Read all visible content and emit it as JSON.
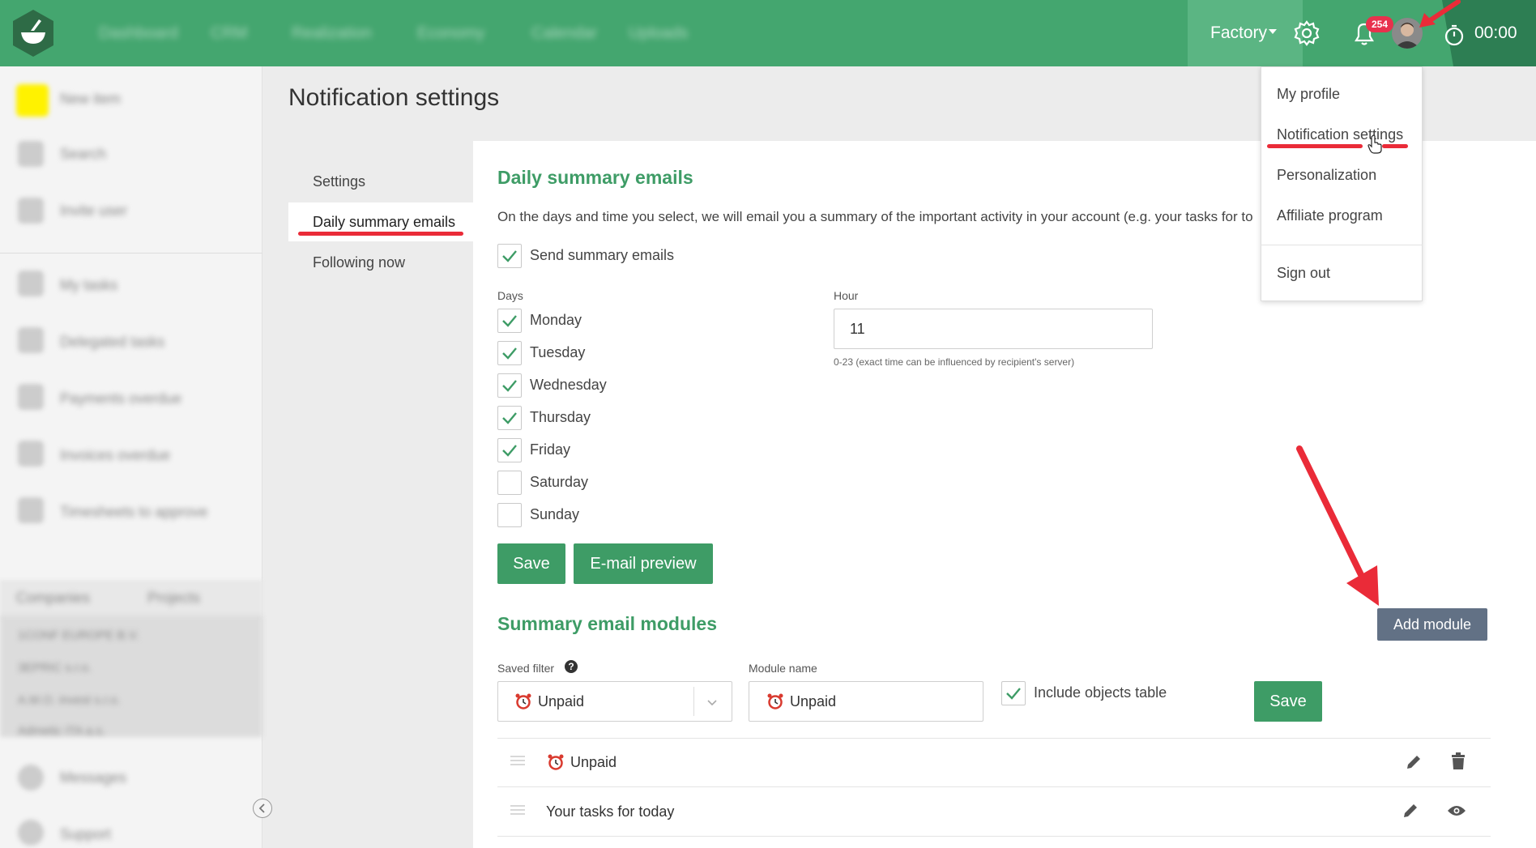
{
  "topbar": {
    "nav_items": [
      "Dashboard",
      "CRM",
      "Realization",
      "Economy",
      "Calendar",
      "Uploads"
    ],
    "company": "Factory",
    "notifications_count": "254",
    "timer": "00:00"
  },
  "sidebar": {
    "items": [
      "New item",
      "Search",
      "Invite user",
      "My tasks",
      "Delegated tasks",
      "Payments overdue",
      "Invoices overdue",
      "Timesheets to approve",
      "Messages",
      "Support"
    ],
    "tabs": [
      "Companies",
      "Projects"
    ],
    "companies": [
      "1CONF EUROPE B.V.",
      "3EPRIC s.r.o.",
      "A.M.O. invest s.r.o.",
      "Admetic ITA a.s."
    ]
  },
  "page": {
    "title": "Notification settings"
  },
  "subnav": {
    "items": [
      "Settings",
      "Daily summary emails",
      "Following now"
    ]
  },
  "daily": {
    "title": "Daily summary emails",
    "description": "On the days and time you select, we will email you a summary of the important activity in your account (e.g. your tasks for to",
    "send_label": "Send summary emails",
    "days_label": "Days",
    "days": [
      {
        "name": "Monday",
        "checked": true
      },
      {
        "name": "Tuesday",
        "checked": true
      },
      {
        "name": "Wednesday",
        "checked": true
      },
      {
        "name": "Thursday",
        "checked": true
      },
      {
        "name": "Friday",
        "checked": true
      },
      {
        "name": "Saturday",
        "checked": false
      },
      {
        "name": "Sunday",
        "checked": false
      }
    ],
    "hour_label": "Hour",
    "hour_value": "11",
    "hour_hint": "0-23 (exact time can be influenced by recipient's server)",
    "save_label": "Save",
    "preview_label": "E-mail preview"
  },
  "modules": {
    "title": "Summary email modules",
    "add_label": "Add module",
    "saved_filter_label": "Saved filter",
    "saved_filter_value": "Unpaid",
    "module_name_label": "Module name",
    "module_name_value": "Unpaid",
    "include_label": "Include objects table",
    "save_label": "Save",
    "rows": [
      "Unpaid",
      "Your tasks for today"
    ]
  },
  "user_menu": {
    "items": [
      "My profile",
      "Notification settings",
      "Personalization",
      "Affiliate program",
      "Sign out"
    ]
  },
  "colors": {
    "brand": "#44a66f",
    "accent_text": "#3e9c66",
    "badge": "#e8314d",
    "add_button": "#627185",
    "annotation": "#ea2b38"
  }
}
